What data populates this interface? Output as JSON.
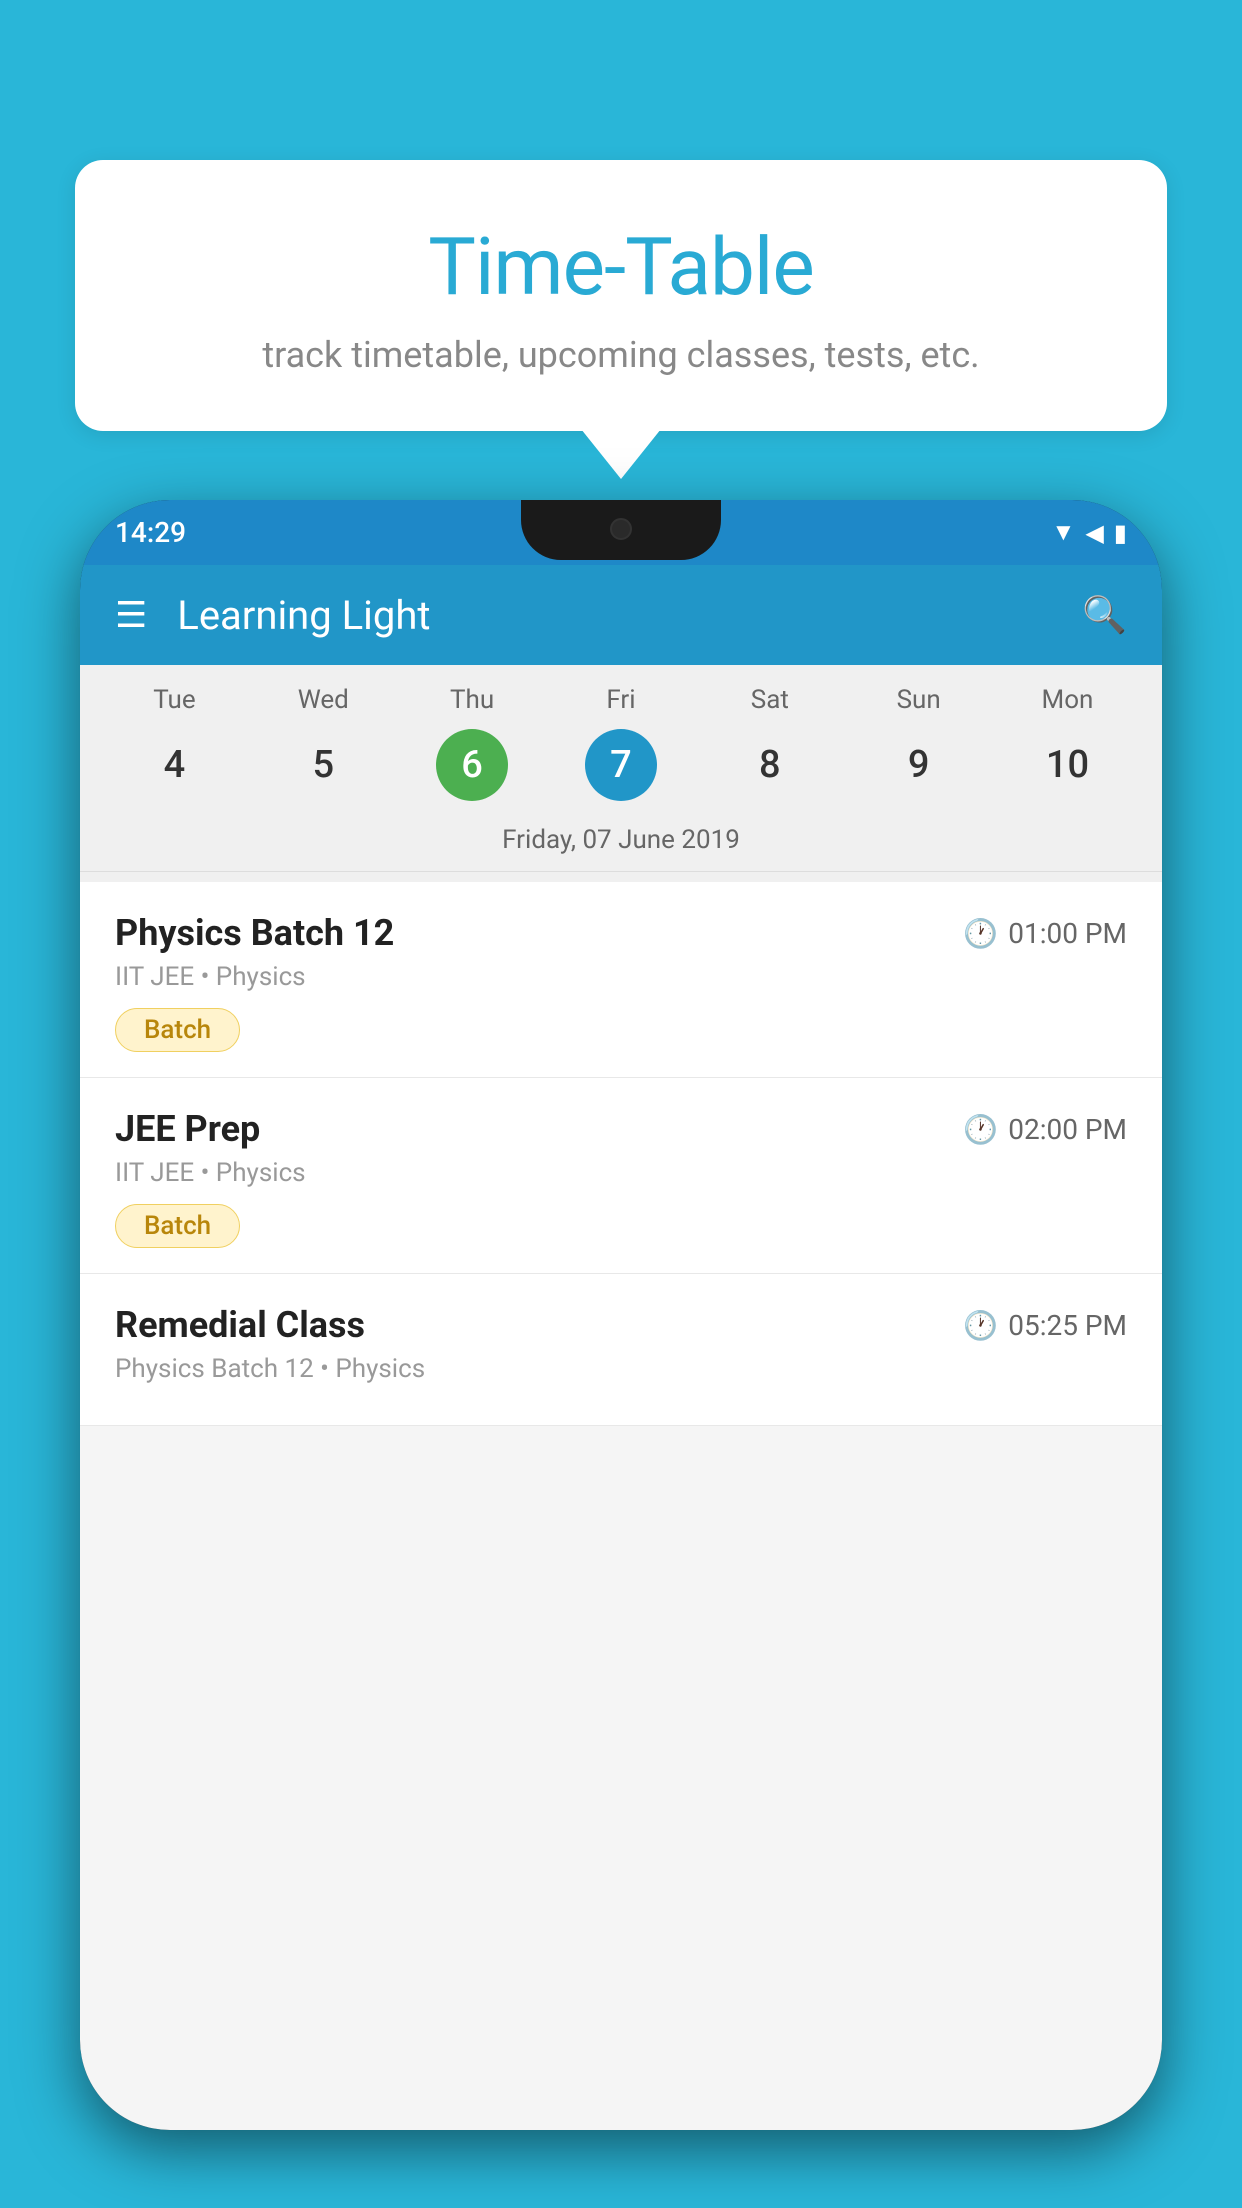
{
  "background_color": "#29b6d8",
  "speech_bubble": {
    "title": "Time-Table",
    "subtitle": "track timetable, upcoming classes, tests, etc."
  },
  "status_bar": {
    "time": "14:29"
  },
  "app_bar": {
    "title": "Learning Light"
  },
  "calendar": {
    "days": [
      {
        "name": "Tue",
        "number": "4",
        "state": "normal"
      },
      {
        "name": "Wed",
        "number": "5",
        "state": "normal"
      },
      {
        "name": "Thu",
        "number": "6",
        "state": "today"
      },
      {
        "name": "Fri",
        "number": "7",
        "state": "selected"
      },
      {
        "name": "Sat",
        "number": "8",
        "state": "normal"
      },
      {
        "name": "Sun",
        "number": "9",
        "state": "normal"
      },
      {
        "name": "Mon",
        "number": "10",
        "state": "normal"
      }
    ],
    "selected_date": "Friday, 07 June 2019"
  },
  "schedule": [
    {
      "title": "Physics Batch 12",
      "time": "01:00 PM",
      "subtitle": "IIT JEE • Physics",
      "tag": "Batch"
    },
    {
      "title": "JEE Prep",
      "time": "02:00 PM",
      "subtitle": "IIT JEE • Physics",
      "tag": "Batch"
    },
    {
      "title": "Remedial Class",
      "time": "05:25 PM",
      "subtitle": "Physics Batch 12 • Physics",
      "tag": ""
    }
  ]
}
